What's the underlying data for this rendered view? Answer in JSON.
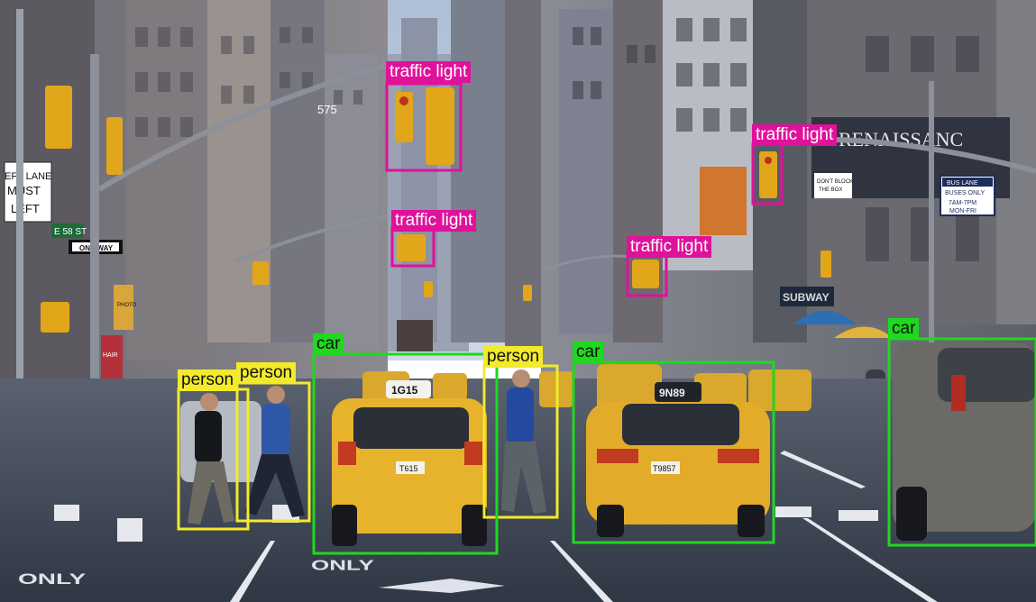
{
  "image": {
    "subject": "city street scene with object detection boxes"
  },
  "colors": {
    "traffic_light": "#e0119a",
    "person": "#f2ea2b",
    "car": "#1fd81f",
    "sky": "#b9c6d8",
    "taxi": "#e7b22c",
    "road": "#3d4654"
  },
  "signs": {
    "left_lane": "EFT LANE",
    "must": "MUST",
    "turn_left": "LEFT",
    "e58": "E 58 ST",
    "one_way": "ONE WAY",
    "passport": "PASSPORT PHOTO",
    "hair": "100% HAIR",
    "bus_lane": "BUS LANE",
    "buses_only": "BUSES ONLY",
    "bus_time": "7AM-7PM",
    "bus_days": "MON-FRI",
    "dont_block": "DON'T BLOCK THE BOX",
    "renaissance": "RENAISSANC",
    "subway": "SUBWAY",
    "number_575": "575",
    "road_only": "ONLY",
    "taxi_a": "1G15",
    "taxi_a_plate": "T615",
    "taxi_b": "9N89",
    "taxi_b_plate": "T9857"
  },
  "detections": [
    {
      "label": "traffic light",
      "cls": "traffic"
    },
    {
      "label": "traffic light",
      "cls": "traffic"
    },
    {
      "label": "traffic light",
      "cls": "traffic"
    },
    {
      "label": "traffic light",
      "cls": "traffic"
    },
    {
      "label": "person",
      "cls": "person"
    },
    {
      "label": "person",
      "cls": "person"
    },
    {
      "label": "person",
      "cls": "person"
    },
    {
      "label": "car",
      "cls": "car"
    },
    {
      "label": "car",
      "cls": "car"
    },
    {
      "label": "car",
      "cls": "car"
    }
  ]
}
